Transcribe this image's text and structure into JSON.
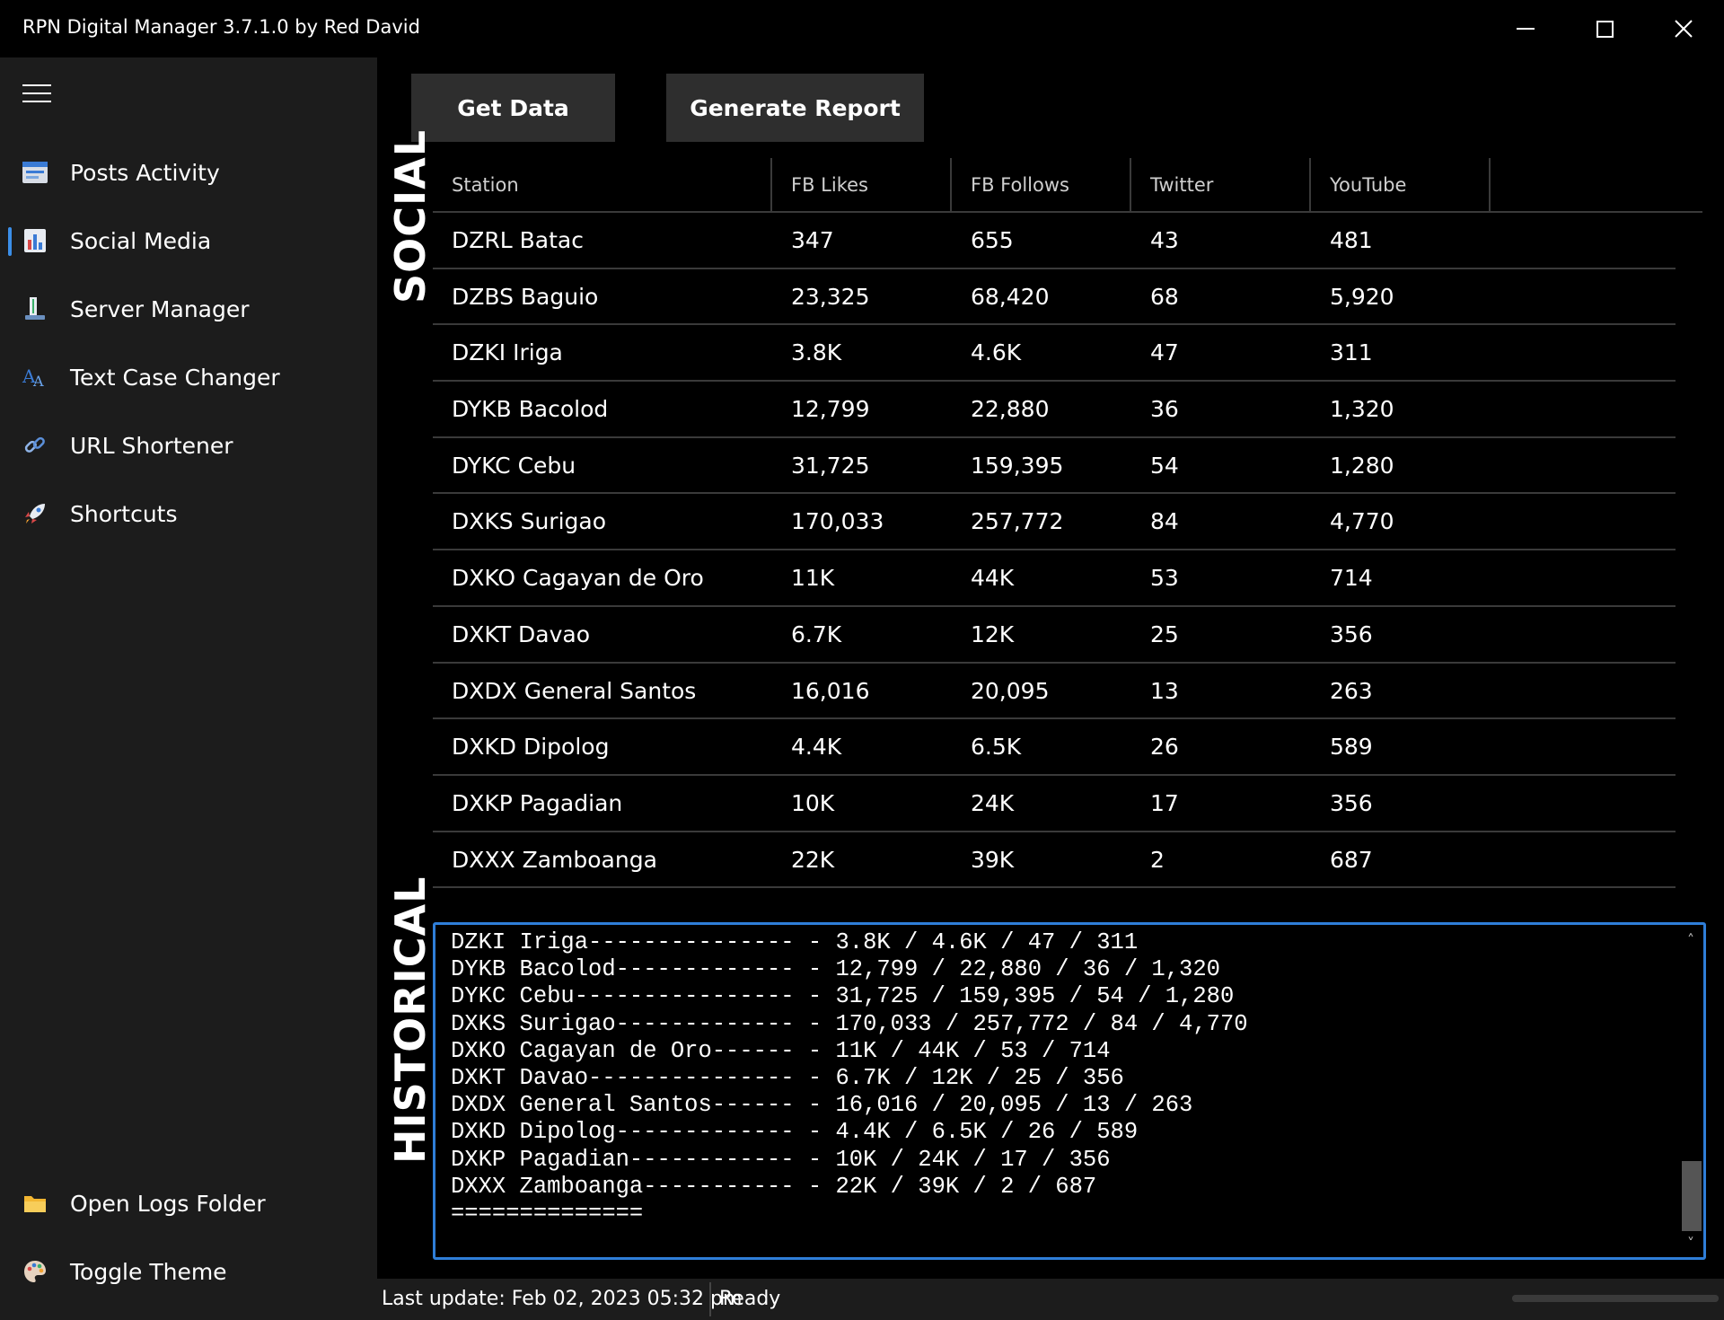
{
  "window": {
    "title": "RPN Digital Manager 3.7.1.0 by Red David"
  },
  "sidebar": {
    "items": [
      {
        "label": "Posts Activity",
        "icon": "posts-icon"
      },
      {
        "label": "Social Media",
        "icon": "bar-chart-icon"
      },
      {
        "label": "Server Manager",
        "icon": "server-icon"
      },
      {
        "label": "Text Case Changer",
        "icon": "text-case-icon"
      },
      {
        "label": "URL Shortener",
        "icon": "link-icon"
      },
      {
        "label": "Shortcuts",
        "icon": "rocket-icon"
      }
    ],
    "bottom_items": [
      {
        "label": "Open Logs Folder",
        "icon": "folder-icon"
      },
      {
        "label": "Toggle Theme",
        "icon": "palette-icon"
      }
    ],
    "active_index": 1
  },
  "toolbar": {
    "get_data_label": "Get Data",
    "generate_report_label": "Generate Report"
  },
  "sections": {
    "social_label": "SOCIAL",
    "historical_label": "HISTORICAL"
  },
  "table": {
    "columns": [
      "Station",
      "FB Likes",
      "FB Follows",
      "Twitter",
      "YouTube"
    ],
    "rows": [
      [
        "DZRL Batac",
        "347",
        "655",
        "43",
        "481"
      ],
      [
        "DZBS Baguio",
        "23,325",
        "68,420",
        "68",
        "5,920"
      ],
      [
        "DZKI Iriga",
        "3.8K",
        "4.6K",
        "47",
        "311"
      ],
      [
        "DYKB Bacolod",
        "12,799",
        "22,880",
        "36",
        "1,320"
      ],
      [
        "DYKC Cebu",
        "31,725",
        "159,395",
        "54",
        "1,280"
      ],
      [
        "DXKS Surigao",
        "170,033",
        "257,772",
        "84",
        "4,770"
      ],
      [
        "DXKO Cagayan de Oro",
        "11K",
        "44K",
        "53",
        "714"
      ],
      [
        "DXKT Davao",
        "6.7K",
        "12K",
        "25",
        "356"
      ],
      [
        "DXDX General Santos",
        "16,016",
        "20,095",
        "13",
        "263"
      ],
      [
        "DXKD Dipolog",
        "4.4K",
        "6.5K",
        "26",
        "589"
      ],
      [
        "DXKP Pagadian",
        "10K",
        "24K",
        "17",
        "356"
      ],
      [
        "DXXX Zamboanga",
        "22K",
        "39K",
        "2",
        "687"
      ]
    ]
  },
  "log": {
    "lines": [
      "DZKI Iriga--------------- - 3.8K / 4.6K / 47 / 311",
      "DYKB Bacolod------------- - 12,799 / 22,880 / 36 / 1,320",
      "DYKC Cebu---------------- - 31,725 / 159,395 / 54 / 1,280",
      "DXKS Surigao------------- - 170,033 / 257,772 / 84 / 4,770",
      "DXKO Cagayan de Oro------ - 11K / 44K / 53 / 714",
      "DXKT Davao--------------- - 6.7K / 12K / 25 / 356",
      "DXDX General Santos------ - 16,016 / 20,095 / 13 / 263",
      "DXKD Dipolog------------- - 4.4K / 6.5K / 26 / 589",
      "DXKP Pagadian------------ - 10K / 24K / 17 / 356",
      "DXXX Zamboanga----------- - 22K / 39K / 2 / 687",
      "=============="
    ]
  },
  "status": {
    "last_update": "Last update: Feb 02, 2023 05:32 pm",
    "state": "Ready"
  },
  "colors": {
    "accent": "#2f7ed8",
    "sidebar_bg": "#1c1c1c",
    "content_bg": "#000000"
  }
}
